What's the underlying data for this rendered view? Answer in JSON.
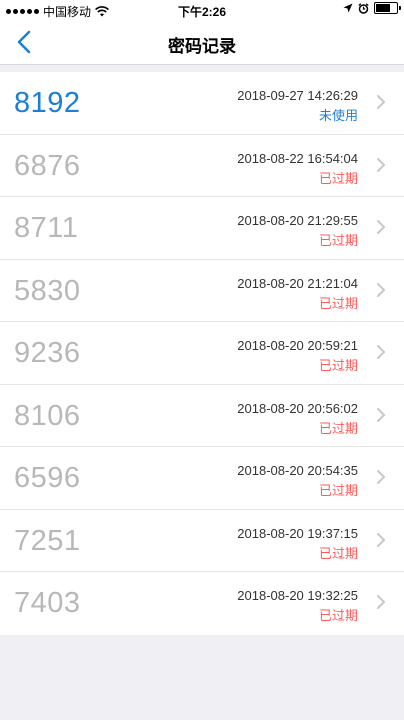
{
  "status_bar": {
    "carrier": "中国移动",
    "time": "下午2:26",
    "battery_level": 0.7
  },
  "nav": {
    "title": "密码记录",
    "back_icon": "chevron-left-icon"
  },
  "colors": {
    "accent": "#1c7ed6",
    "expired": "#ff5a5a",
    "inactive_code": "#b8b8b8"
  },
  "records": [
    {
      "code": "8192",
      "datetime": "2018-09-27 14:26:29",
      "status": "未使用",
      "active": true
    },
    {
      "code": "6876",
      "datetime": "2018-08-22 16:54:04",
      "status": "已过期",
      "active": false
    },
    {
      "code": "8711",
      "datetime": "2018-08-20 21:29:55",
      "status": "已过期",
      "active": false
    },
    {
      "code": "5830",
      "datetime": "2018-08-20 21:21:04",
      "status": "已过期",
      "active": false
    },
    {
      "code": "9236",
      "datetime": "2018-08-20 20:59:21",
      "status": "已过期",
      "active": false
    },
    {
      "code": "8106",
      "datetime": "2018-08-20 20:56:02",
      "status": "已过期",
      "active": false
    },
    {
      "code": "6596",
      "datetime": "2018-08-20 20:54:35",
      "status": "已过期",
      "active": false
    },
    {
      "code": "7251",
      "datetime": "2018-08-20 19:37:15",
      "status": "已过期",
      "active": false
    },
    {
      "code": "7403",
      "datetime": "2018-08-20 19:32:25",
      "status": "已过期",
      "active": false
    }
  ]
}
